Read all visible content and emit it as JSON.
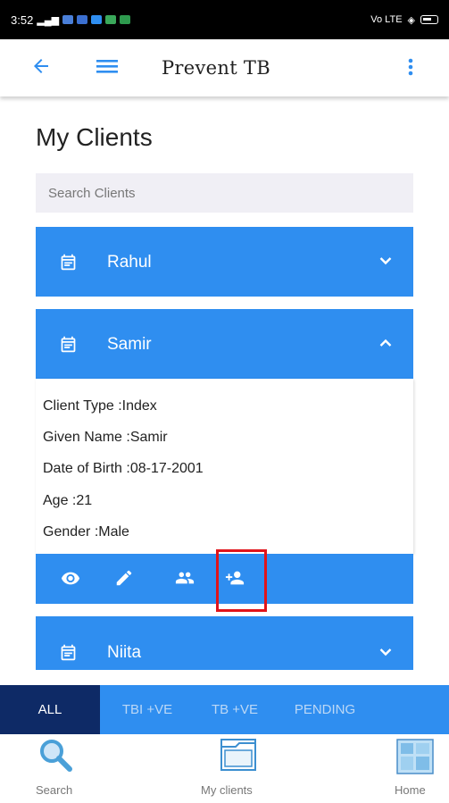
{
  "status_bar": {
    "time": "3:52",
    "right_text": "Vo LTE"
  },
  "app_bar": {
    "title": "Prevent TB"
  },
  "page": {
    "title": "My Clients"
  },
  "search": {
    "placeholder": "Search Clients",
    "value": ""
  },
  "clients": [
    {
      "name": "Rahul",
      "expanded": false
    },
    {
      "name": "Samir",
      "expanded": true,
      "details": {
        "client_type": "Client Type :Index",
        "given_name": "Given Name :Samir",
        "dob": "Date of Birth :08-17-2001",
        "age": "Age :21",
        "gender": "Gender :Male"
      },
      "actions": [
        "view-icon",
        "edit-icon",
        "group-icon",
        "add-contact-icon"
      ]
    },
    {
      "name": "Niita",
      "expanded": false
    }
  ],
  "filter_tabs": [
    {
      "label": "ALL",
      "active": true
    },
    {
      "label": "TBI +VE",
      "active": false
    },
    {
      "label": "TB +VE",
      "active": false
    },
    {
      "label": "PENDING",
      "active": false
    }
  ],
  "bottom_nav": [
    {
      "label": "Search",
      "icon": "magnifier-icon"
    },
    {
      "label": "My clients",
      "icon": "folder-icon"
    },
    {
      "label": "Home",
      "icon": "home-grid-icon"
    }
  ],
  "colors": {
    "accent": "#2f8ef0",
    "active_tab": "#0e2a66",
    "highlight": "#e0141a"
  }
}
